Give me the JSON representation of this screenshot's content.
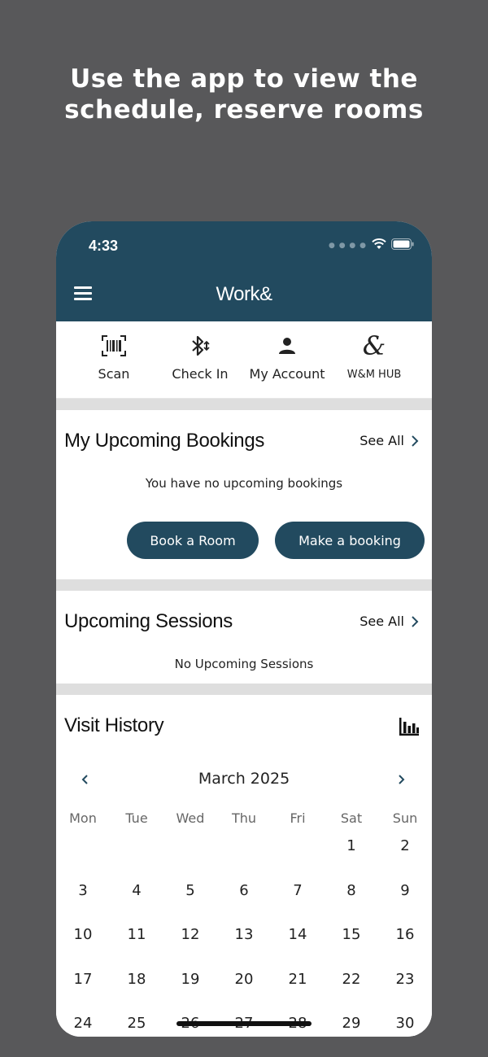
{
  "promo": {
    "line1": "Use the app to view the",
    "line2": "schedule, reserve rooms"
  },
  "status_bar": {
    "time": "4:33",
    "icons": [
      "signal-icon",
      "wifi-icon",
      "battery-icon"
    ]
  },
  "header": {
    "title": "Work&",
    "menu_icon": "hamburger-icon"
  },
  "quick_actions": [
    {
      "label": "Scan",
      "icon": "barcode-scan-icon"
    },
    {
      "label": "Check In",
      "icon": "bluetooth-icon"
    },
    {
      "label": "My Account",
      "icon": "person-icon"
    },
    {
      "label": "W&M HUB",
      "icon": "ampersand-logo-icon"
    }
  ],
  "bookings": {
    "title": "My Upcoming Bookings",
    "see_all": "See All",
    "empty": "You have no upcoming bookings",
    "book_room": "Book a Room",
    "make_booking": "Make a booking"
  },
  "sessions": {
    "title": "Upcoming Sessions",
    "see_all": "See All",
    "empty": "No Upcoming Sessions"
  },
  "visit_history": {
    "title": "Visit History",
    "chart_icon": "bar-chart-icon",
    "month": "March 2025",
    "weekdays": [
      "Mon",
      "Tue",
      "Wed",
      "Thu",
      "Fri",
      "Sat",
      "Sun"
    ],
    "weeks": [
      [
        "",
        "",
        "",
        "",
        "",
        "1",
        "2"
      ],
      [
        "3",
        "4",
        "5",
        "6",
        "7",
        "8",
        "9"
      ],
      [
        "10",
        "11",
        "12",
        "13",
        "14",
        "15",
        "16"
      ],
      [
        "17",
        "18",
        "19",
        "20",
        "21",
        "22",
        "23"
      ],
      [
        "24",
        "25",
        "26",
        "27",
        "28",
        "29",
        "30"
      ]
    ]
  },
  "colors": {
    "primary": "#224a5f",
    "background": "#58585a",
    "separator": "#dedede"
  }
}
